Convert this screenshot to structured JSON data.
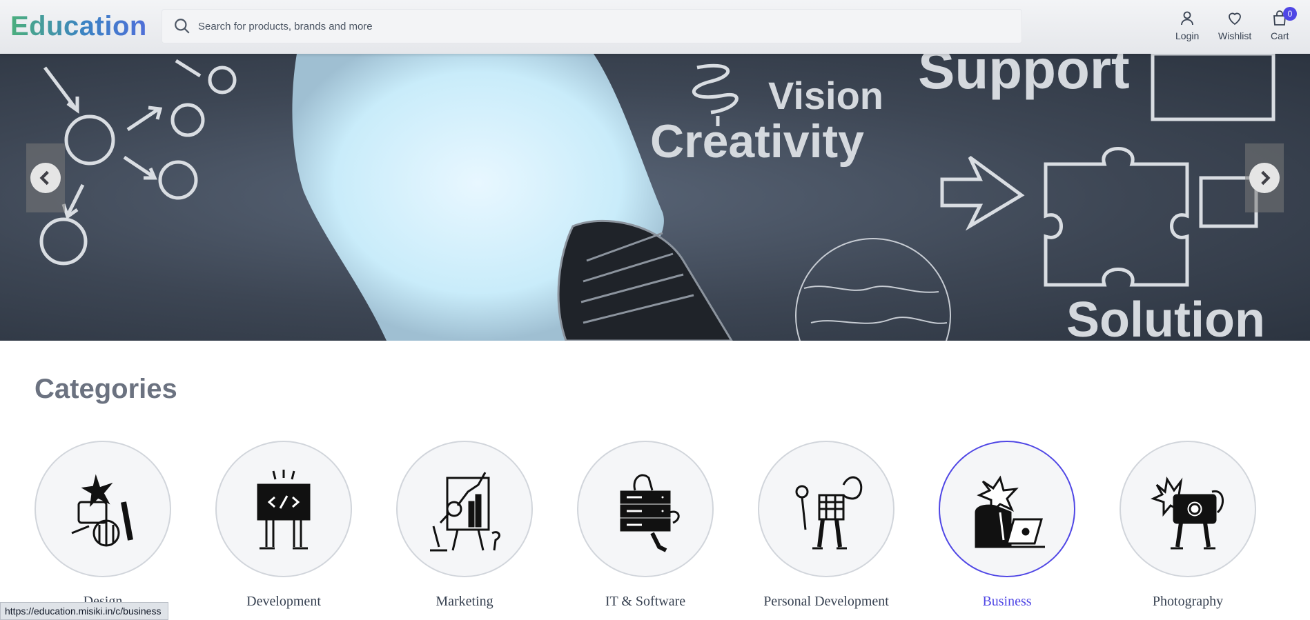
{
  "header": {
    "logo": "Education",
    "search_placeholder": "Search for products, brands and more",
    "login_label": "Login",
    "wishlist_label": "Wishlist",
    "cart_label": "Cart",
    "cart_count": "0"
  },
  "hero": {
    "words": [
      "Vision",
      "Creativity",
      "Support",
      "Solution"
    ]
  },
  "categories": {
    "title": "Categories",
    "items": [
      {
        "label": "Design"
      },
      {
        "label": "Development"
      },
      {
        "label": "Marketing"
      },
      {
        "label": "IT & Software"
      },
      {
        "label": "Personal Development"
      },
      {
        "label": "Business"
      },
      {
        "label": "Photography"
      }
    ],
    "active": "Business"
  },
  "status_url": "https://education.misiki.in/c/business",
  "colors": {
    "accent": "#4f46e5",
    "title_gray": "#6b7280",
    "hero_dark": "#3d4654"
  }
}
